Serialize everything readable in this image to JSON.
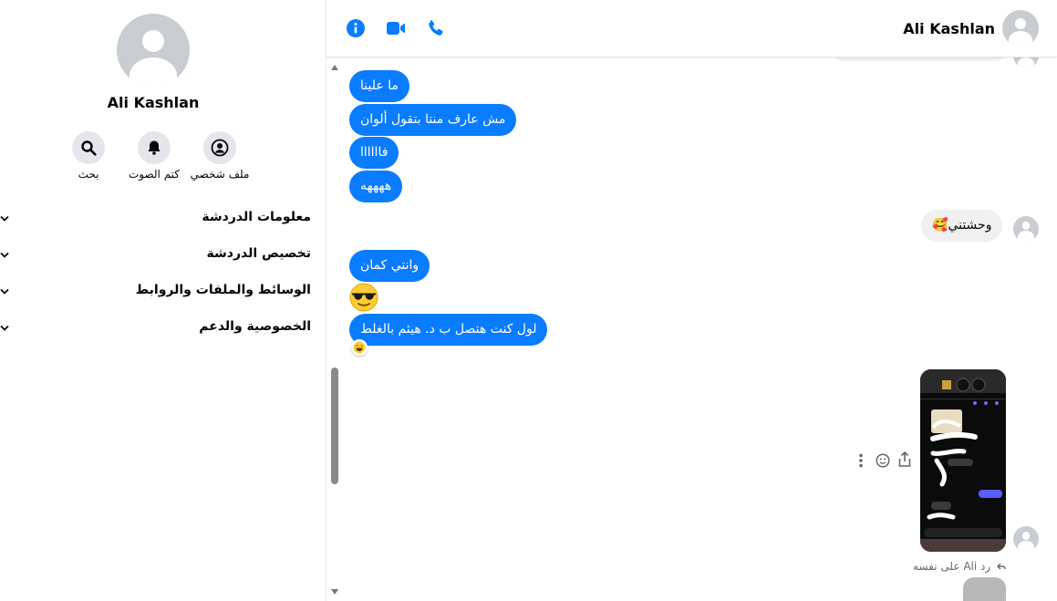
{
  "sidebar": {
    "name": "Ali Kashlan",
    "actions": [
      {
        "label": "ملف شخصي",
        "icon": "profile-icon"
      },
      {
        "label": "كتم الصوت",
        "icon": "bell-icon"
      },
      {
        "label": "بحث",
        "icon": "search-icon"
      }
    ],
    "menu": [
      {
        "label": "معلومات الدردشة"
      },
      {
        "label": "تخصيص الدردشة"
      },
      {
        "label": "الوسائط والملفات والروابط"
      },
      {
        "label": "الخصوصية والدعم"
      }
    ]
  },
  "header": {
    "contact_name": "Ali Kashlan",
    "icons": [
      "info-icon",
      "video-call-icon",
      "phone-icon"
    ],
    "accent_color": "#0a7cff"
  },
  "messages": [
    {
      "dir": "out",
      "text": "ما علينا"
    },
    {
      "dir": "out",
      "text": "مش عارف منتا بتقول ألوان"
    },
    {
      "dir": "out",
      "text": "فاااااا"
    },
    {
      "dir": "out",
      "text": "ههههه"
    },
    {
      "dir": "in",
      "text": "وحشتني🥰"
    },
    {
      "dir": "out",
      "text": "وانتي كمان"
    },
    {
      "dir": "out",
      "text": "😎",
      "kind": "emoji"
    },
    {
      "dir": "out",
      "text": "لول كنت هتصل ب د. هيثم بالغلط",
      "reaction": "😆"
    },
    {
      "dir": "in",
      "kind": "photo",
      "reply_note": "رد Ali على نفسه"
    }
  ]
}
